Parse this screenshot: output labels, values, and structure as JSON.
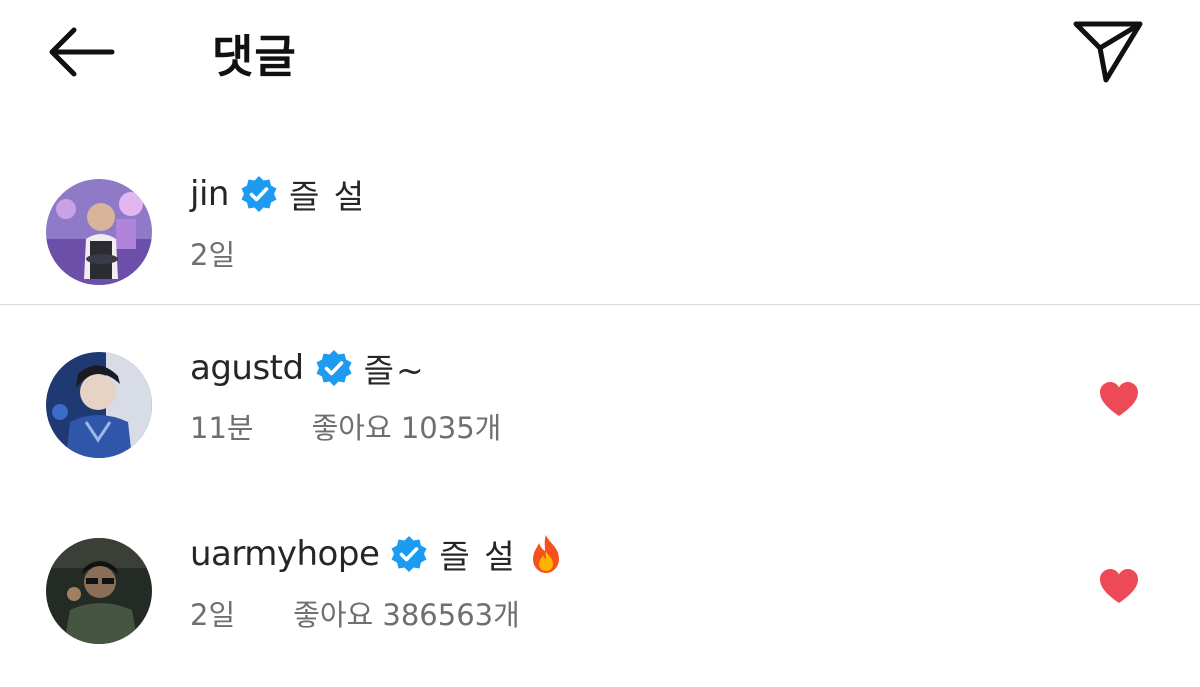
{
  "header": {
    "title": "댓글"
  },
  "colors": {
    "verified": "#1d9bf0",
    "heart": "#ed4956",
    "meta_text": "#6f6f6f"
  },
  "comments": [
    {
      "username": "jin",
      "text": "즐 설",
      "time": "2일",
      "likes": ""
    },
    {
      "username": "agustd",
      "text": "즐~",
      "time": "11분",
      "likes": "좋아요 1035개"
    },
    {
      "username": "uarmyhope",
      "text": "즐 설",
      "time": "2일",
      "likes": "좋아요 386563개"
    }
  ],
  "icons": {
    "back": "back-arrow-icon",
    "share": "paper-plane-icon",
    "verified": "verified-badge-icon",
    "heart": "heart-icon",
    "fire": "fire-emoji-icon"
  }
}
